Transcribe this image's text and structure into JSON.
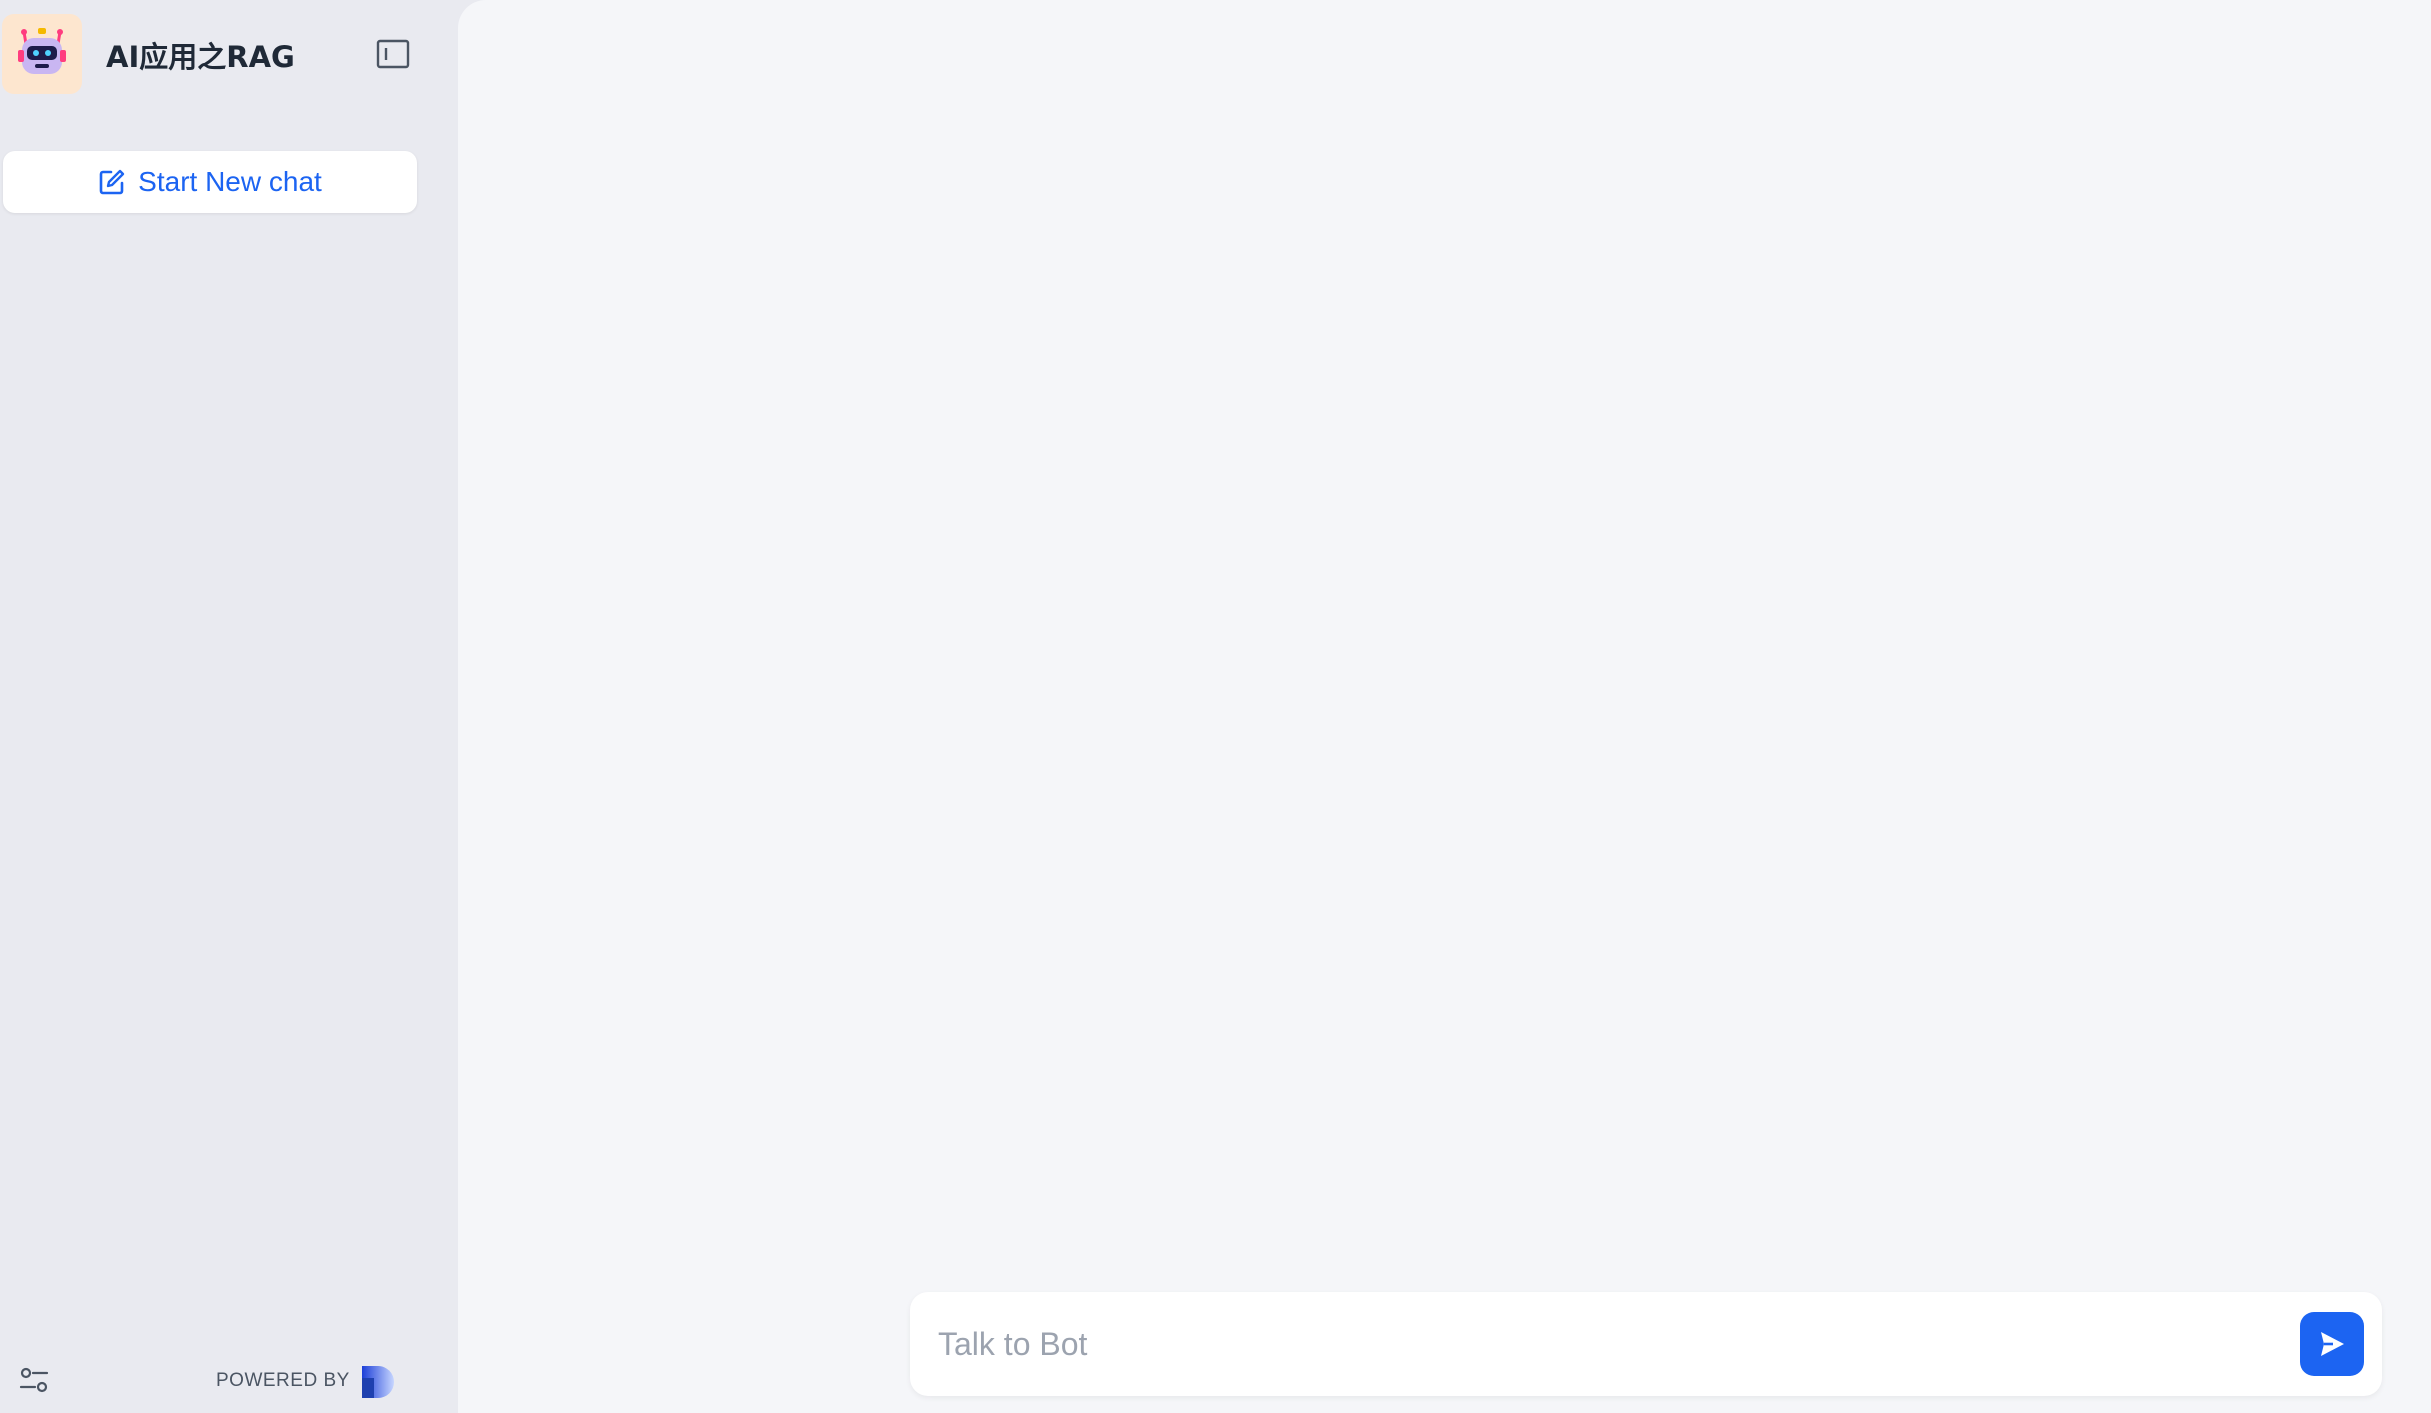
{
  "app": {
    "title": "AI应用之RAG",
    "icon": "robot-avatar-icon"
  },
  "sidebar": {
    "collapse_icon": "sidebar-collapse-icon",
    "new_chat": {
      "label": "Start New chat",
      "icon": "edit-square-icon"
    },
    "footer": {
      "settings_icon": "settings-sliders-icon",
      "powered_by": "POWERED BY",
      "brand_icon": "dify-logo-icon"
    }
  },
  "composer": {
    "placeholder": "Talk to Bot",
    "value": "",
    "send_icon": "send-arrow-icon"
  },
  "colors": {
    "accent": "#1c64f2",
    "sidebar_bg": "#e9eaf0",
    "main_bg": "#f5f6f9",
    "icon_bg": "#fde6cf"
  }
}
